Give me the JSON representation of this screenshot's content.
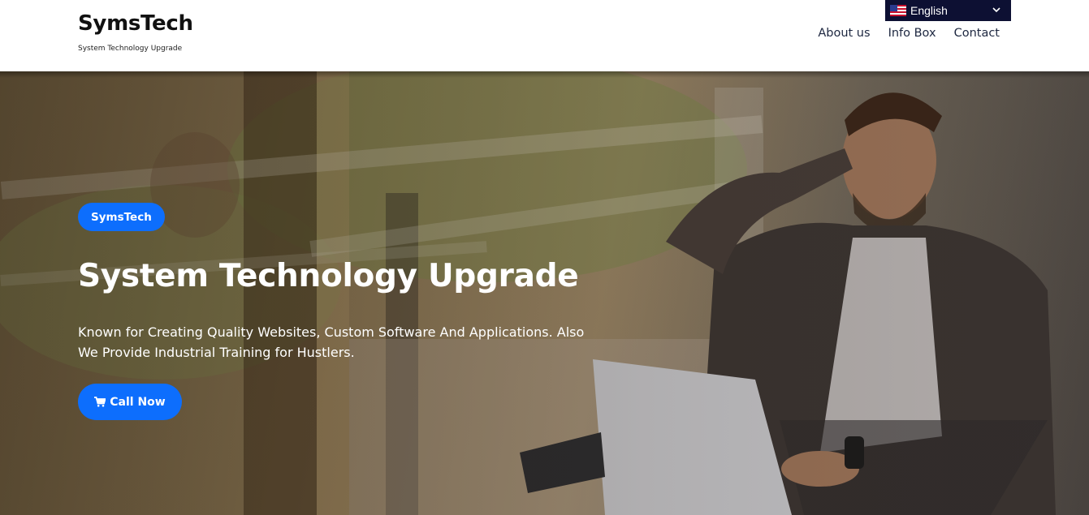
{
  "site": {
    "brand_name": "SymsTech",
    "tagline": "System Technology Upgrade"
  },
  "nav": {
    "items": [
      "About us",
      "Info Box",
      "Contact"
    ]
  },
  "language_selector": {
    "label": "English",
    "icon": "us-flag-icon"
  },
  "hero": {
    "badge": "SymsTech",
    "title": "System Technology Upgrade",
    "description_line1": "Known for Creating Quality Websites, Custom Software And Applications. Also",
    "description_line2": "We Provide Industrial Training for Hustlers.",
    "cta_label": "Call Now",
    "cta_icon": "cart-icon"
  },
  "colors": {
    "accent": "#0d6efd",
    "language_bar": "#0d1033",
    "nav_text": "#1d2740"
  }
}
